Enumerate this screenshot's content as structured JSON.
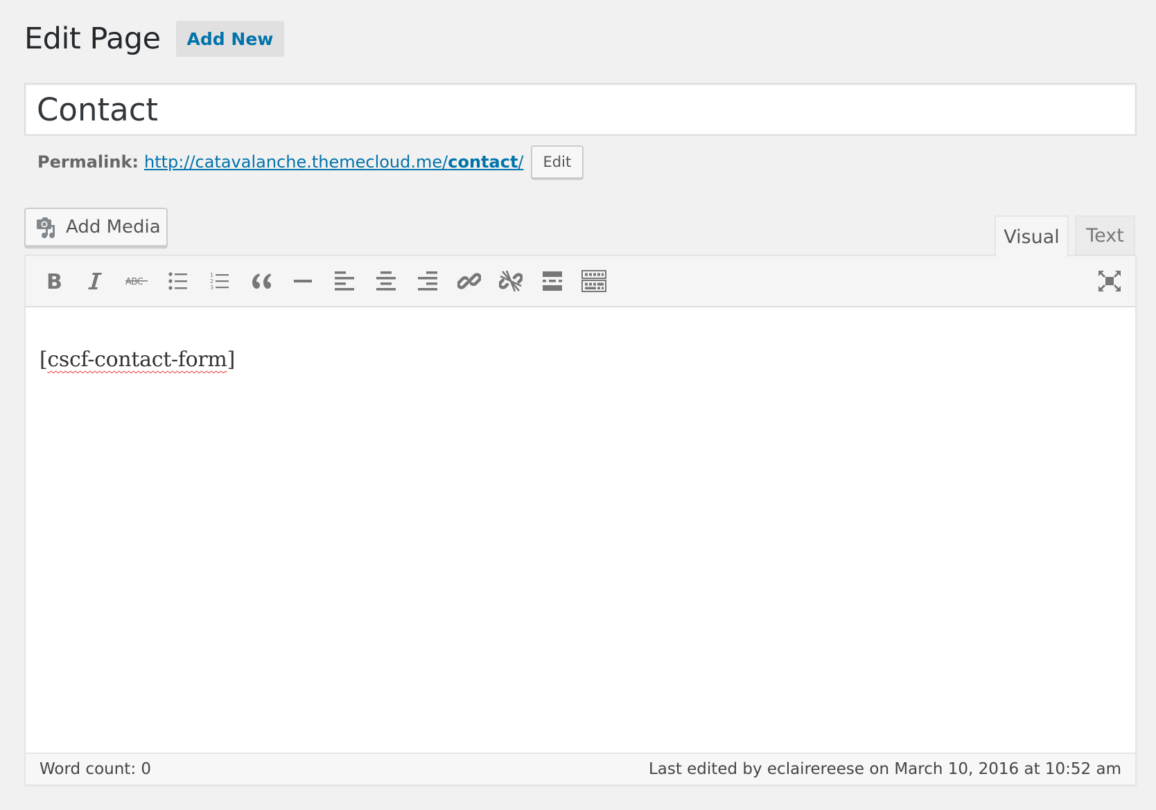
{
  "header": {
    "title": "Edit Page",
    "add_new_label": "Add New"
  },
  "post": {
    "title_value": "Contact",
    "permalink_label": "Permalink:",
    "permalink_base": "http://catavalanche.themecloud.me/",
    "permalink_slug": "contact",
    "permalink_trailing": "/",
    "edit_slug_label": "Edit"
  },
  "editor": {
    "add_media_label": "Add Media",
    "tabs": [
      {
        "label": "Visual",
        "active": true
      },
      {
        "label": "Text",
        "active": false
      }
    ],
    "toolbar": [
      {
        "icon": "bold-icon",
        "label": "Bold"
      },
      {
        "icon": "italic-icon",
        "label": "Italic"
      },
      {
        "icon": "strikethrough-icon",
        "label": "Strikethrough"
      },
      {
        "icon": "bulleted-list-icon",
        "label": "Bulleted list"
      },
      {
        "icon": "numbered-list-icon",
        "label": "Numbered list"
      },
      {
        "icon": "blockquote-icon",
        "label": "Blockquote"
      },
      {
        "icon": "horizontal-line-icon",
        "label": "Horizontal line"
      },
      {
        "icon": "align-left-icon",
        "label": "Align left"
      },
      {
        "icon": "align-center-icon",
        "label": "Align center"
      },
      {
        "icon": "align-right-icon",
        "label": "Align right"
      },
      {
        "icon": "insert-link-icon",
        "label": "Insert/edit link"
      },
      {
        "icon": "unlink-icon",
        "label": "Remove link"
      },
      {
        "icon": "read-more-icon",
        "label": "Insert Read More tag"
      },
      {
        "icon": "toolbar-toggle-icon",
        "label": "Toolbar Toggle"
      }
    ],
    "fullscreen_icon": "fullscreen-icon",
    "content": "[cscf-contact-form]",
    "word_count": "Word count: 0",
    "last_edited": "Last edited by eclairereese on March 10, 2016 at 10:52 am"
  },
  "colors": {
    "link": "#0073aa",
    "background": "#f1f1f1",
    "icon": "#777777"
  }
}
